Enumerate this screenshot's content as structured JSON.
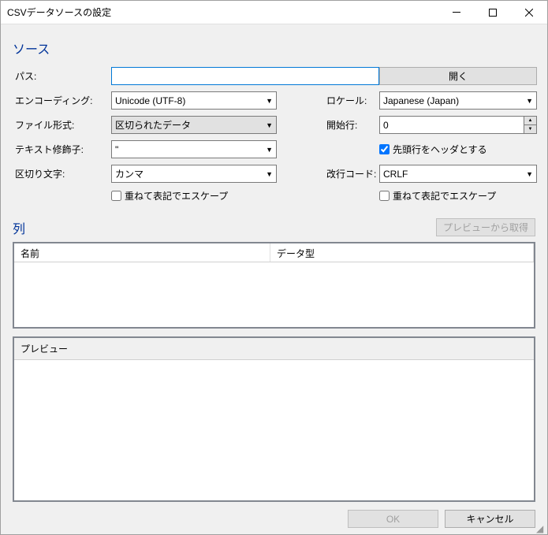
{
  "window": {
    "title": "CSVデータソースの設定"
  },
  "section_source": "ソース",
  "labels": {
    "path": "パス:",
    "encoding": "エンコーディング:",
    "locale": "ロケール:",
    "file_format": "ファイル形式:",
    "start_row": "開始行:",
    "text_qualifier": "テキスト修飾子:",
    "delimiter": "区切り文字:",
    "newline": "改行コード:"
  },
  "values": {
    "path": "",
    "encoding": "Unicode (UTF-8)",
    "locale": "Japanese (Japan)",
    "file_format": "区切られたデータ",
    "start_row": "0",
    "text_qualifier": "\"",
    "delimiter": "カンマ",
    "newline": "CRLF"
  },
  "buttons": {
    "open": "開く",
    "get_from_preview": "プレビューから取得",
    "ok": "OK",
    "cancel": "キャンセル"
  },
  "checkboxes": {
    "first_row_header": "先頭行をヘッダとする",
    "escape_delim": "重ねて表記でエスケープ",
    "escape_newline": "重ねて表記でエスケープ"
  },
  "section_columns": "列",
  "table": {
    "col_name": "名前",
    "col_type": "データ型"
  },
  "preview_label": "プレビュー"
}
